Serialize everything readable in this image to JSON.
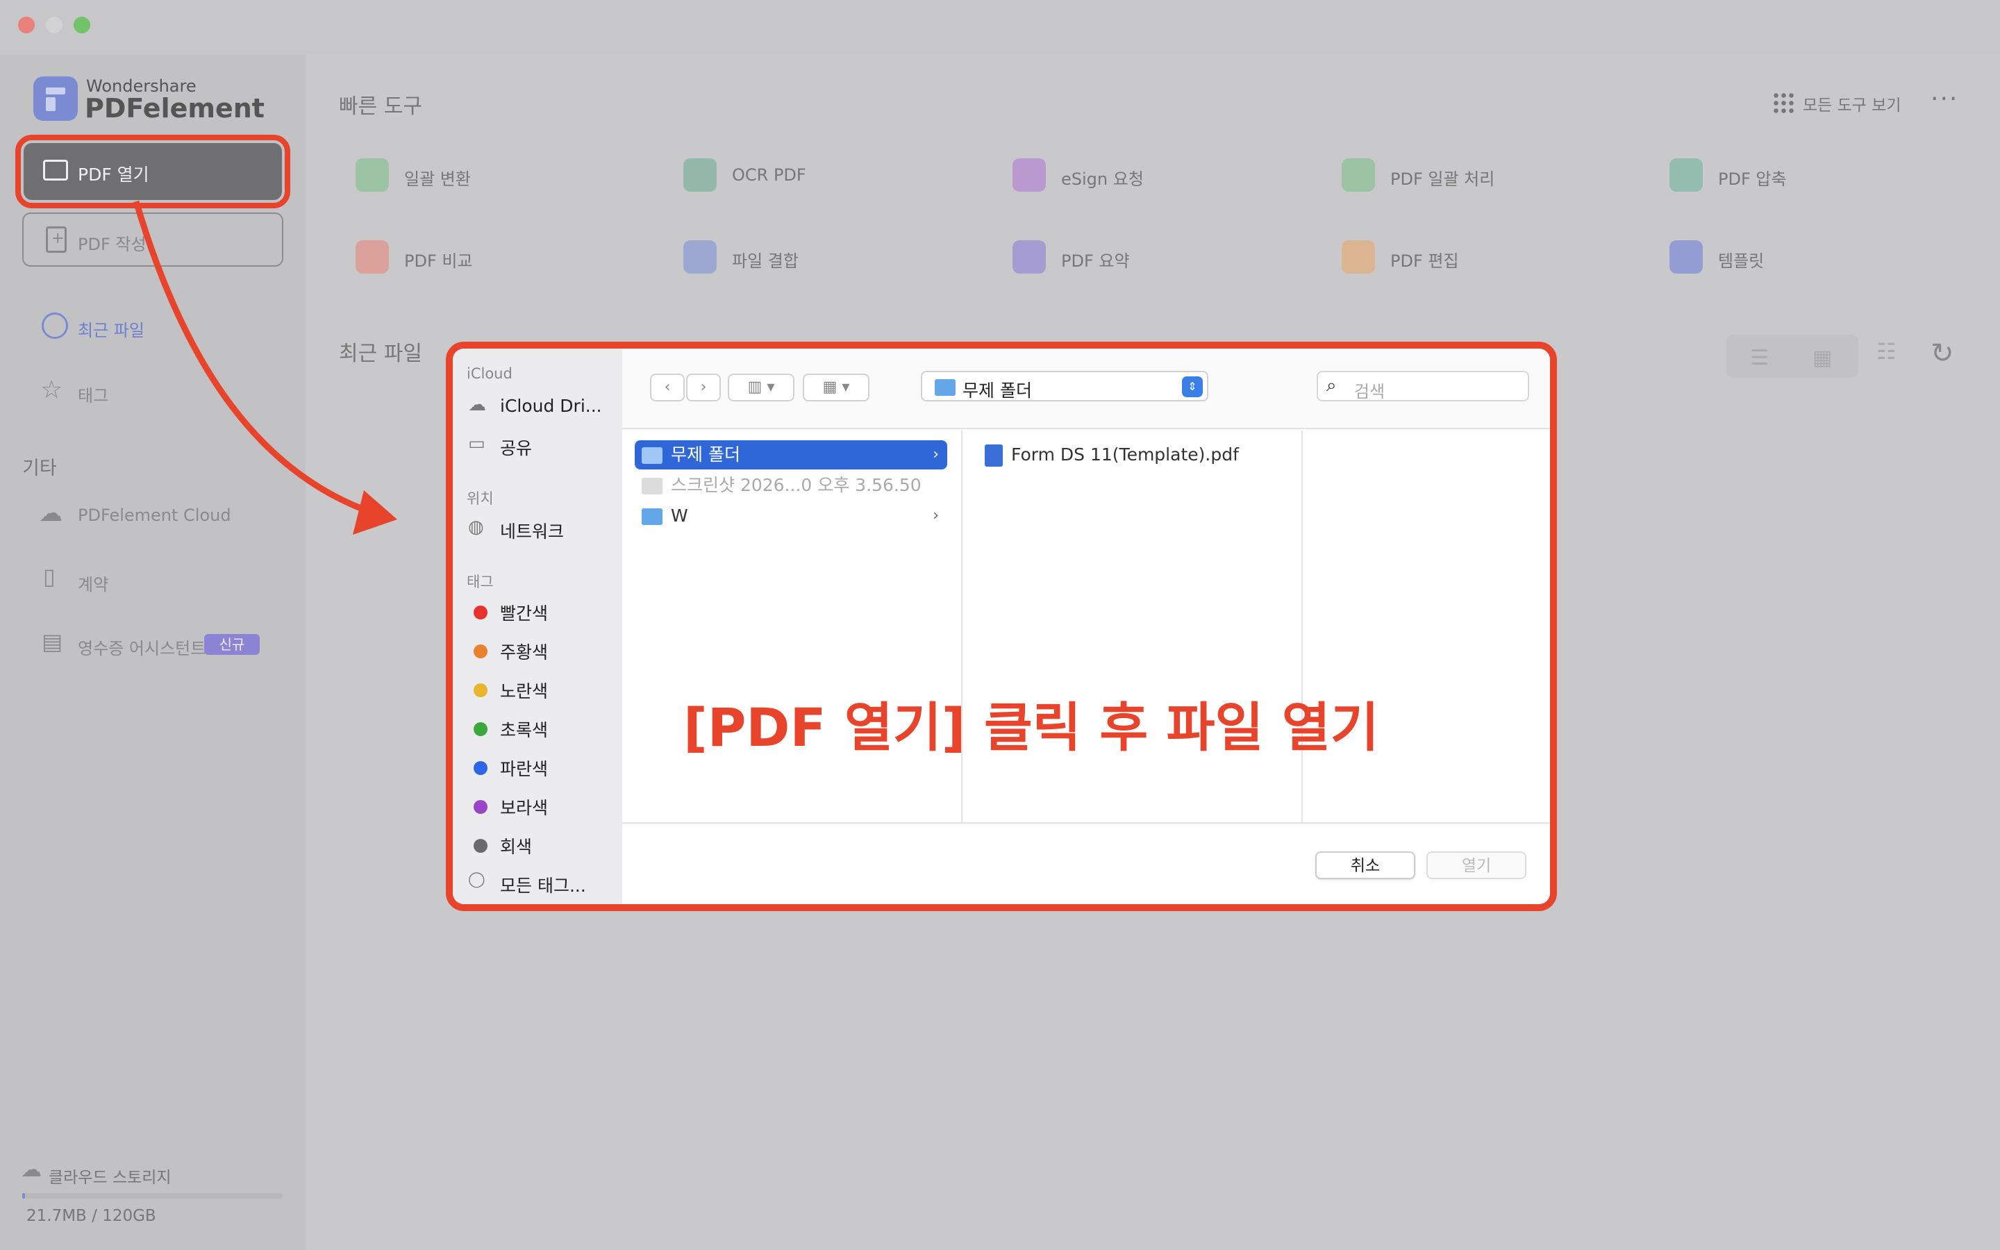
{
  "app": {
    "brand_top": "Wondershare",
    "brand_main": "PDFelement"
  },
  "sidebar": {
    "open_pdf": "PDF 열기",
    "create_pdf": "PDF 작성",
    "recent": "최근 파일",
    "tags": "태그",
    "section_other": "기타",
    "cloud": "PDFelement Cloud",
    "contract": "계약",
    "receipt": "영수증 어시스턴트",
    "receipt_badge": "신규",
    "storage_label": "클라우드 스토리지",
    "storage_value": "21.7MB / 120GB",
    "storage_used_fraction": 0.0002
  },
  "main": {
    "quick_tools_title": "빠른 도구",
    "all_tools": "모든 도구 보기",
    "more": "···",
    "recent_title": "최근 파일",
    "tools": [
      {
        "label": "일괄 변환",
        "color": "#7fbf8a"
      },
      {
        "label": "OCR PDF",
        "color": "#6fae95"
      },
      {
        "label": "eSign 요청",
        "color": "#b07ad6"
      },
      {
        "label": "PDF 일괄 처리",
        "color": "#7fbf8a"
      },
      {
        "label": "PDF 압축",
        "color": "#6fb59c"
      },
      {
        "label": "PDF 비교",
        "color": "#e8857a"
      },
      {
        "label": "파일 결합",
        "color": "#7e92d6"
      },
      {
        "label": "PDF 요약",
        "color": "#8e7ed6"
      },
      {
        "label": "PDF 편집",
        "color": "#e8a86a"
      },
      {
        "label": "템플릿",
        "color": "#6f7ed8"
      }
    ]
  },
  "dialog": {
    "sidebar": {
      "icloud_section": "iCloud",
      "icloud_drive": "iCloud Dri...",
      "shared": "공유",
      "location_section": "위치",
      "network": "네트워크",
      "tags_section": "태그",
      "tags": [
        {
          "label": "빨간색",
          "color": "#e8322e"
        },
        {
          "label": "주황색",
          "color": "#e8822e"
        },
        {
          "label": "노란색",
          "color": "#eab52e"
        },
        {
          "label": "초록색",
          "color": "#3aa83a"
        },
        {
          "label": "파란색",
          "color": "#2e66e8"
        },
        {
          "label": "보라색",
          "color": "#9a44c8"
        },
        {
          "label": "회색",
          "color": "#6a6a6e"
        }
      ],
      "all_tags": "모든 태그..."
    },
    "path": "무제 폴더",
    "search_placeholder": "검색",
    "column1": [
      {
        "label": "무제 폴더",
        "state": "selected",
        "chevron": "›"
      },
      {
        "label": "스크린샷 2026...0 오후 3.56.50",
        "state": "dim",
        "chevron": ""
      },
      {
        "label": "W",
        "state": "normal",
        "chevron": "›"
      }
    ],
    "column2": [
      {
        "label": "Form DS 11(Template).pdf"
      }
    ],
    "cancel": "취소",
    "open": "열기"
  },
  "annotation": "[PDF 열기] 클릭 후 파일 열기",
  "colors": {
    "annotation_red": "#e8432b",
    "brand": "#7a8bd4",
    "selection_blue": "#2f66d8"
  }
}
